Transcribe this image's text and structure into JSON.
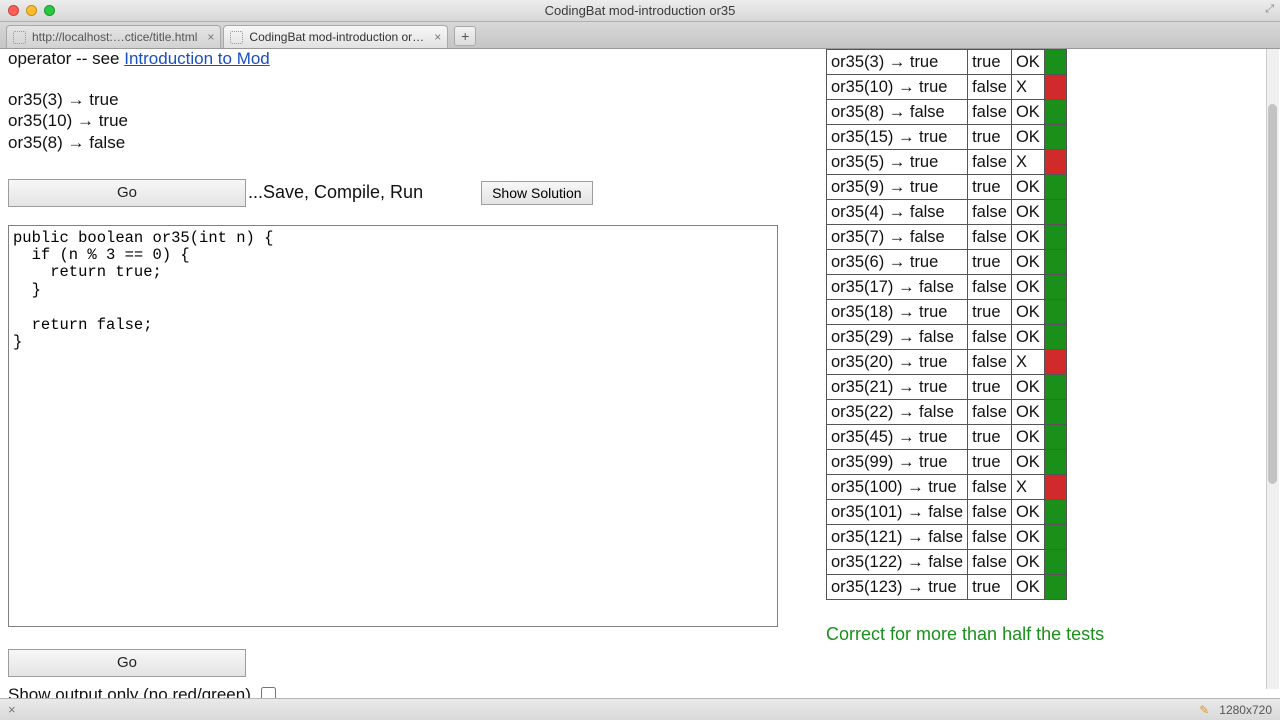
{
  "window": {
    "title": "CodingBat mod-introduction or35"
  },
  "tabs": {
    "t1": "http://localhost:…ctice/title.html",
    "t2": "CodingBat mod-introduction or…"
  },
  "intro": {
    "prefix": "operator -- see ",
    "link": "Introduction to Mod"
  },
  "examples": {
    "e1": "or35(3) → true",
    "e2": "or35(10) → true",
    "e3": "or35(8) → false"
  },
  "buttons": {
    "go": "Go",
    "save_compile_run": "...Save, Compile, Run",
    "show_solution": "Show Solution"
  },
  "code": "public boolean or35(int n) {\n  if (n % 3 == 0) {\n    return true;\n  }\n\n  return false;\n}",
  "checkbox_label": "Show output only (no red/green)",
  "results": [
    {
      "expected": "or35(3) → true",
      "run": "true",
      "status": "OK",
      "color": "green"
    },
    {
      "expected": "or35(10) → true",
      "run": "false",
      "status": "X",
      "color": "red"
    },
    {
      "expected": "or35(8) → false",
      "run": "false",
      "status": "OK",
      "color": "green"
    },
    {
      "expected": "or35(15) → true",
      "run": "true",
      "status": "OK",
      "color": "green"
    },
    {
      "expected": "or35(5) → true",
      "run": "false",
      "status": "X",
      "color": "red"
    },
    {
      "expected": "or35(9) → true",
      "run": "true",
      "status": "OK",
      "color": "green"
    },
    {
      "expected": "or35(4) → false",
      "run": "false",
      "status": "OK",
      "color": "green"
    },
    {
      "expected": "or35(7) → false",
      "run": "false",
      "status": "OK",
      "color": "green"
    },
    {
      "expected": "or35(6) → true",
      "run": "true",
      "status": "OK",
      "color": "green"
    },
    {
      "expected": "or35(17) → false",
      "run": "false",
      "status": "OK",
      "color": "green"
    },
    {
      "expected": "or35(18) → true",
      "run": "true",
      "status": "OK",
      "color": "green"
    },
    {
      "expected": "or35(29) → false",
      "run": "false",
      "status": "OK",
      "color": "green"
    },
    {
      "expected": "or35(20) → true",
      "run": "false",
      "status": "X",
      "color": "red"
    },
    {
      "expected": "or35(21) → true",
      "run": "true",
      "status": "OK",
      "color": "green"
    },
    {
      "expected": "or35(22) → false",
      "run": "false",
      "status": "OK",
      "color": "green"
    },
    {
      "expected": "or35(45) → true",
      "run": "true",
      "status": "OK",
      "color": "green"
    },
    {
      "expected": "or35(99) → true",
      "run": "true",
      "status": "OK",
      "color": "green"
    },
    {
      "expected": "or35(100) → true",
      "run": "false",
      "status": "X",
      "color": "red"
    },
    {
      "expected": "or35(101) → false",
      "run": "false",
      "status": "OK",
      "color": "green"
    },
    {
      "expected": "or35(121) → false",
      "run": "false",
      "status": "OK",
      "color": "green"
    },
    {
      "expected": "or35(122) → false",
      "run": "false",
      "status": "OK",
      "color": "green"
    },
    {
      "expected": "or35(123) → true",
      "run": "true",
      "status": "OK",
      "color": "green"
    }
  ],
  "summary": "Correct for more than half the tests",
  "statusbar": {
    "dims": "1280x720"
  }
}
